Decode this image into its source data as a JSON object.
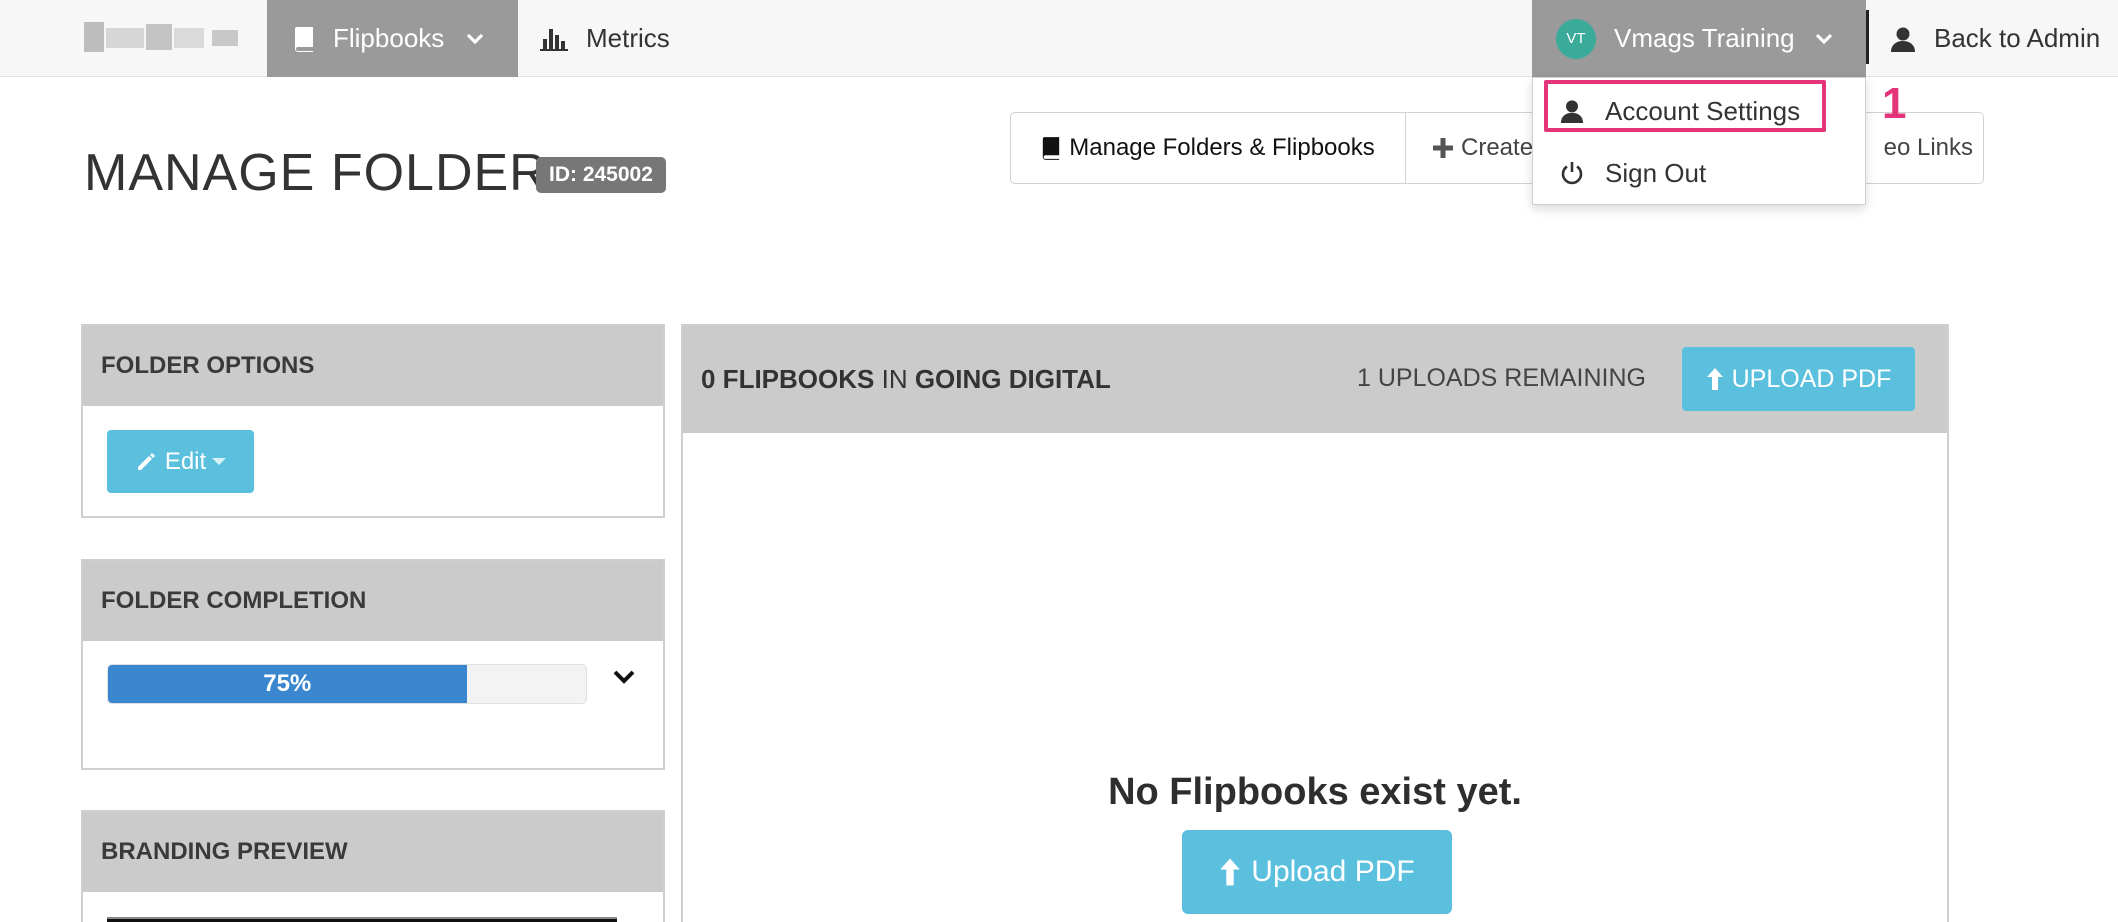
{
  "nav": {
    "flipbooks_label": "Flipbooks",
    "metrics_label": "Metrics",
    "user_initials": "VT",
    "user_name": "Vmags Training",
    "back_label": "Back to Admin"
  },
  "user_menu": {
    "items": [
      {
        "label": "Account Settings",
        "icon": "user-icon"
      },
      {
        "label": "Sign Out",
        "icon": "power-icon"
      }
    ],
    "annotation_step": "1"
  },
  "header": {
    "title": "MANAGE FOLDER:",
    "id_badge": "ID: 245002",
    "manage_label": "Manage Folders & Flipbooks",
    "create_label": "Create",
    "links_label": "eo Links"
  },
  "folder_options": {
    "title": "FOLDER OPTIONS",
    "edit_label": "Edit"
  },
  "folder_completion": {
    "title": "FOLDER COMPLETION",
    "percent": 75,
    "percent_label": "75%"
  },
  "branding": {
    "title": "BRANDING PREVIEW"
  },
  "flipbooks_panel": {
    "count_label": "0 FLIPBOOKS",
    "in_label": "IN",
    "folder_name": "GOING DIGITAL",
    "uploads_remaining": "1 UPLOADS REMAINING",
    "upload_button": "UPLOAD PDF",
    "empty_message": "No Flipbooks exist yet.",
    "upload_big_button": "Upload PDF"
  },
  "colors": {
    "nav_active": "#9a9a9a",
    "accent": "#5bc0de",
    "progress": "#3b87cf",
    "annotation": "#e4357a",
    "avatar": "#3aaa9a"
  }
}
